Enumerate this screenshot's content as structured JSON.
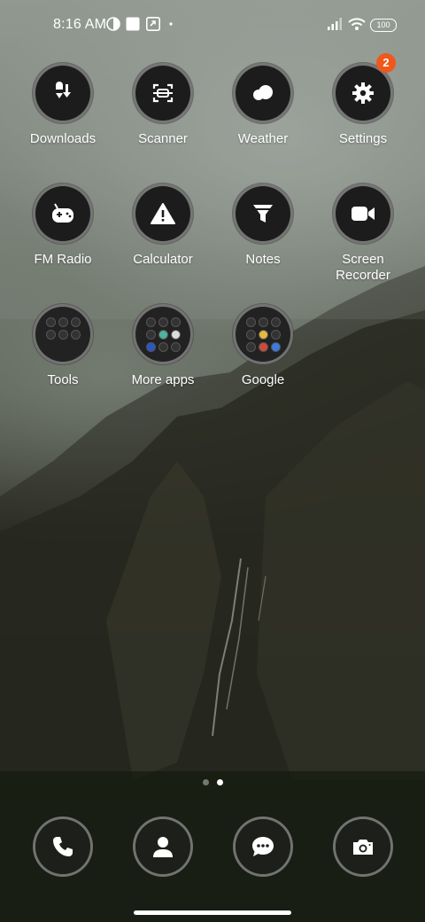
{
  "status_bar": {
    "time": "8:16 AM",
    "battery": "100",
    "icons": [
      "data-saver-icon",
      "notification-square-icon",
      "upload-box-icon",
      "dot-icon",
      "signal-icon",
      "wifi-icon",
      "battery-icon"
    ]
  },
  "apps": [
    {
      "label": "Downloads",
      "icon": "downloads-icon"
    },
    {
      "label": "Scanner",
      "icon": "scanner-icon"
    },
    {
      "label": "Weather",
      "icon": "weather-icon"
    },
    {
      "label": "Settings",
      "icon": "settings-icon",
      "badge": "2"
    },
    {
      "label": "FM Radio",
      "icon": "radio-icon"
    },
    {
      "label": "Calculator",
      "icon": "warning-icon"
    },
    {
      "label": "Notes",
      "icon": "funnel-icon"
    },
    {
      "label": "Screen Recorder",
      "icon": "video-camera-icon"
    },
    {
      "label": "Tools",
      "icon": "folder-icon"
    },
    {
      "label": "More apps",
      "icon": "folder-icon"
    },
    {
      "label": "Google",
      "icon": "folder-icon"
    }
  ],
  "dock": [
    {
      "name": "phone",
      "icon": "phone-icon"
    },
    {
      "name": "contacts",
      "icon": "contacts-icon"
    },
    {
      "name": "messages",
      "icon": "messages-icon"
    },
    {
      "name": "camera",
      "icon": "camera-icon"
    }
  ],
  "pages": {
    "count": 2,
    "active": 2
  },
  "colors": {
    "badge": "#f0581b",
    "icon_bg": "#1c1c1c",
    "ring": "#787878"
  }
}
